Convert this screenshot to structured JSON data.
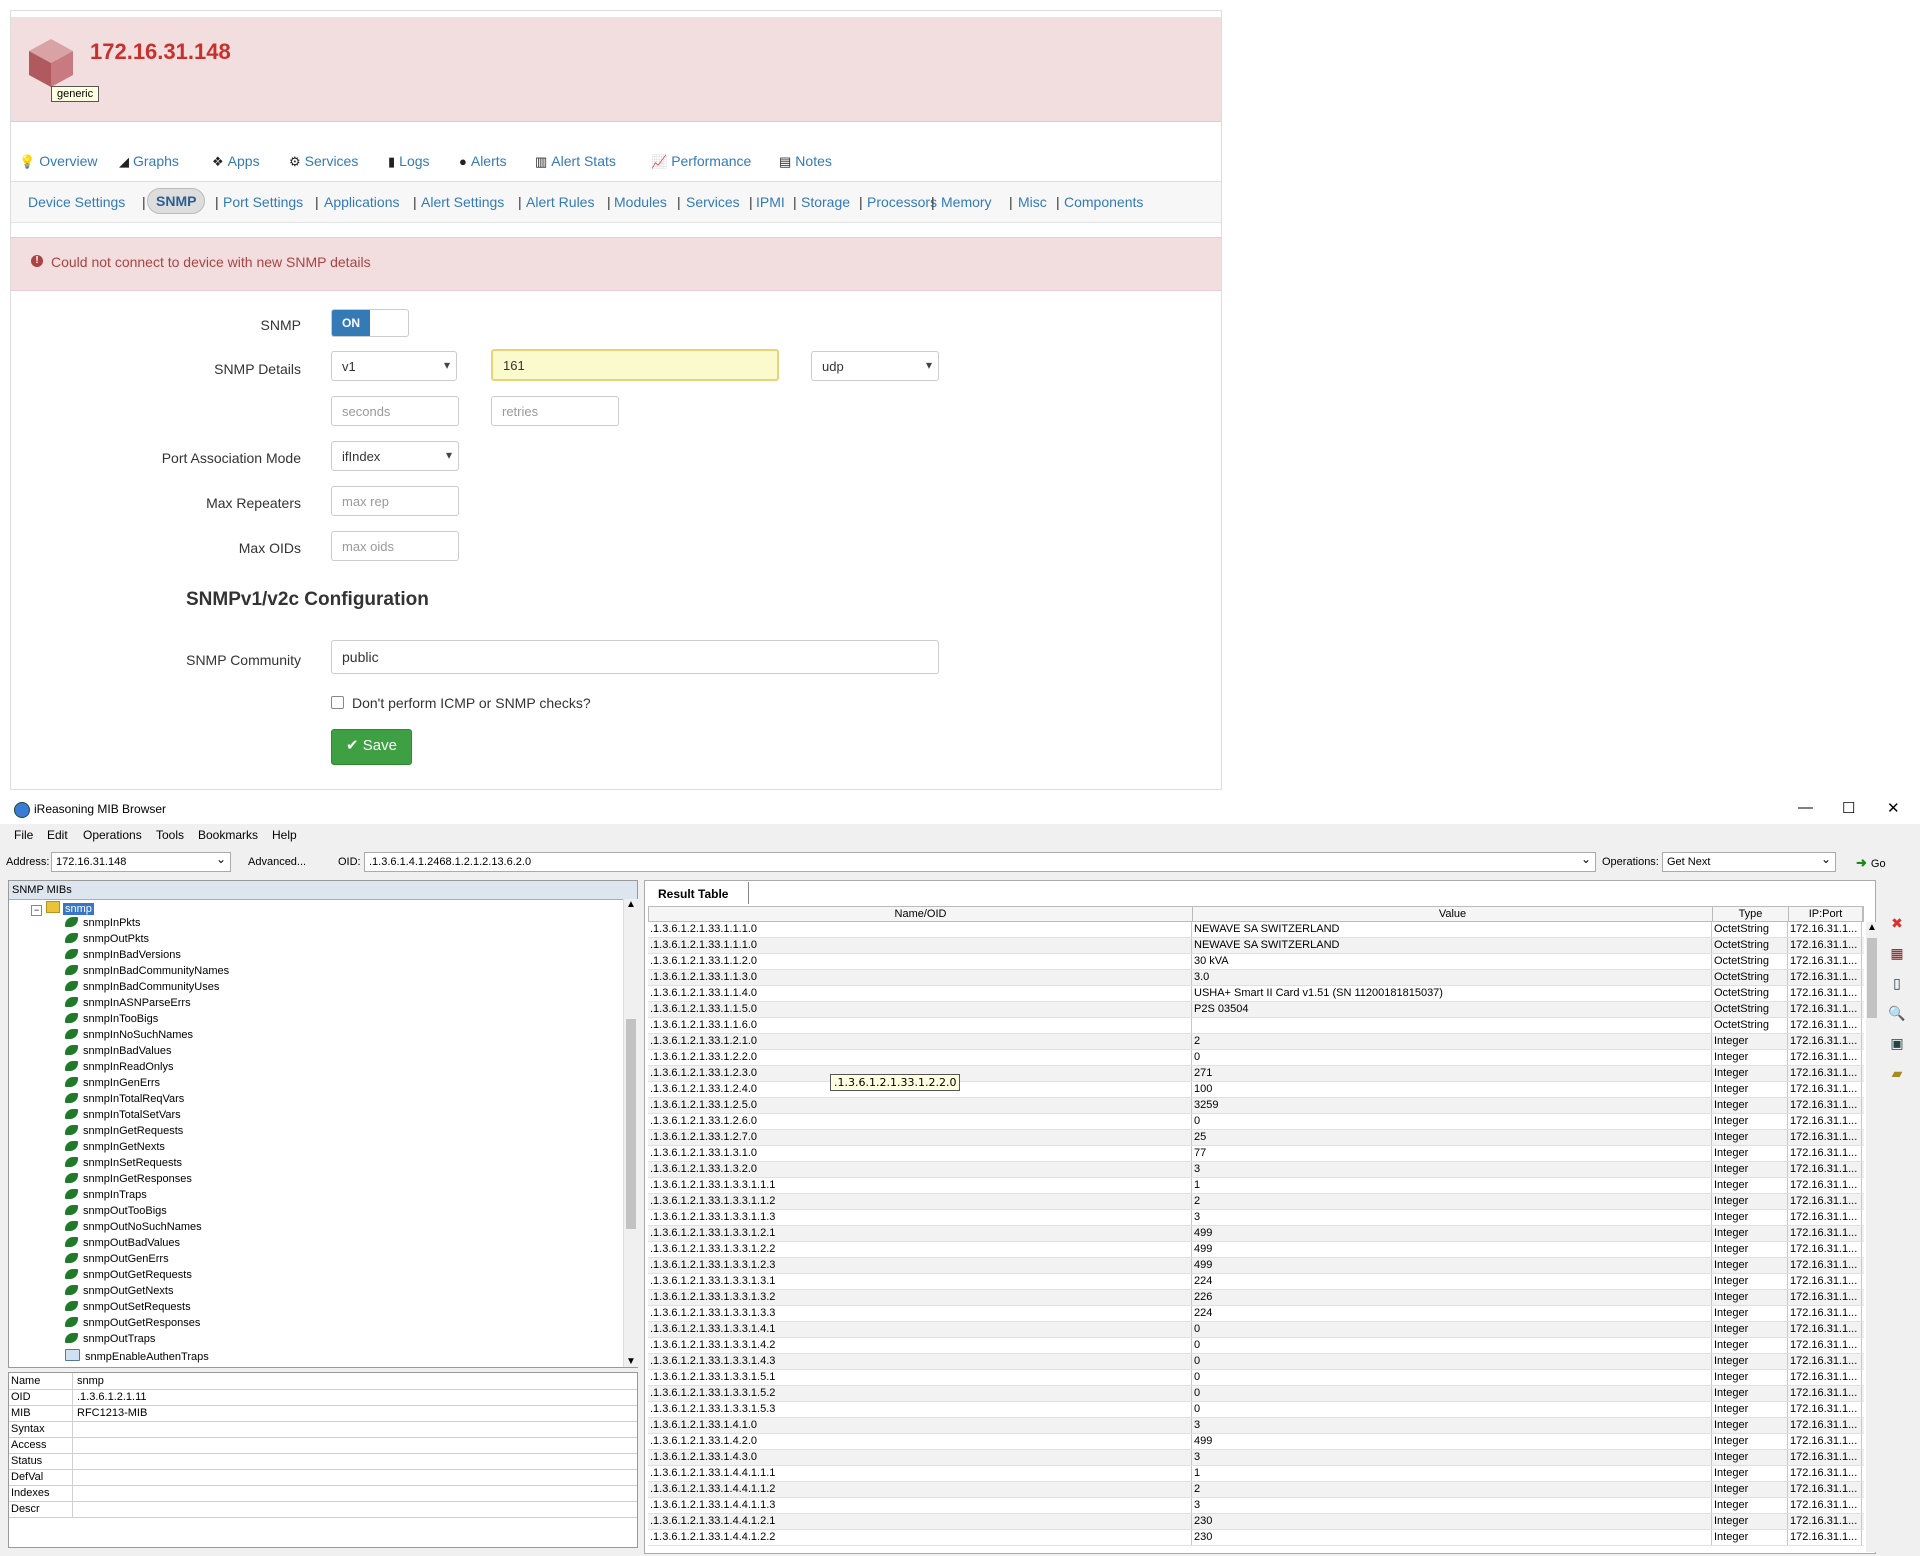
{
  "device": {
    "hostname": "172.16.31.148",
    "tooltip": "generic"
  },
  "main_nav": [
    {
      "label": "Overview",
      "icon": "lightbulb-icon",
      "glyph": "💡"
    },
    {
      "label": "Graphs",
      "icon": "area-chart-icon",
      "glyph": "◢"
    },
    {
      "label": "Apps",
      "icon": "cubes-icon",
      "glyph": "❖"
    },
    {
      "label": "Services",
      "icon": "cogs-icon",
      "glyph": "⚙"
    },
    {
      "label": "Logs",
      "icon": "book-icon",
      "glyph": "▮"
    },
    {
      "label": "Alerts",
      "icon": "exclamation-circle-icon",
      "glyph": "●"
    },
    {
      "label": "Alert Stats",
      "icon": "bar-chart-icon",
      "glyph": "▥"
    },
    {
      "label": "Performance",
      "icon": "line-chart-icon",
      "glyph": "📈"
    },
    {
      "label": "Notes",
      "icon": "file-text-icon",
      "glyph": "▤"
    }
  ],
  "sub_nav": {
    "device_settings": "Device Settings",
    "snmp": "SNMP",
    "items": [
      "Port Settings",
      "Applications",
      "Alert Settings",
      "Alert Rules",
      "Modules",
      "Services",
      "IPMI",
      "Storage",
      "Processors",
      "Memory",
      "Misc",
      "Components"
    ],
    "separator": "|"
  },
  "alert": {
    "message": "Could not connect to device with new SNMP details",
    "icon_glyph": "!"
  },
  "form": {
    "snmp_label": "SNMP",
    "snmp_toggle": "ON",
    "snmp_details_label": "SNMP Details",
    "version": "v1",
    "port": "161",
    "transport": "udp",
    "timeout_placeholder": "seconds",
    "retries_placeholder": "retries",
    "port_assoc_label": "Port Association Mode",
    "port_assoc": "ifIndex",
    "max_repeaters_label": "Max Repeaters",
    "max_repeaters_placeholder": "max rep",
    "max_oids_label": "Max OIDs",
    "max_oids_placeholder": "max oids",
    "config_title": "SNMPv1/v2c Configuration",
    "community_label": "SNMP Community",
    "community": "public",
    "no_checks_label": "Don't perform ICMP or SNMP checks?",
    "save_label": "Save",
    "save_glyph": "✔"
  },
  "mib": {
    "window_title": "iReasoning MIB Browser",
    "window_buttons": [
      "—",
      "☐",
      "✕"
    ],
    "menu": [
      "File",
      "Edit",
      "Operations",
      "Tools",
      "Bookmarks",
      "Help"
    ],
    "address_label": "Address:",
    "address": "172.16.31.148",
    "advanced_label": "Advanced...",
    "oid_label": "OID:",
    "oid": ".1.3.6.1.4.1.2468.1.2.1.2.13.6.2.0",
    "operations_label": "Operations:",
    "operation": "Get Next",
    "go_label": "Go",
    "go_glyph": "➜",
    "tree_header": "SNMP MIBs",
    "tree_root": "snmp",
    "tree_expander": "−",
    "tree_items": [
      "snmpInPkts",
      "snmpOutPkts",
      "snmpInBadVersions",
      "snmpInBadCommunityNames",
      "snmpInBadCommunityUses",
      "snmpInASNParseErrs",
      "snmpInTooBigs",
      "snmpInNoSuchNames",
      "snmpInBadValues",
      "snmpInReadOnlys",
      "snmpInGenErrs",
      "snmpInTotalReqVars",
      "snmpInTotalSetVars",
      "snmpInGetRequests",
      "snmpInGetNexts",
      "snmpInSetRequests",
      "snmpInGetResponses",
      "snmpInTraps",
      "snmpOutTooBigs",
      "snmpOutNoSuchNames",
      "snmpOutBadValues",
      "snmpOutGenErrs",
      "snmpOutGetRequests",
      "snmpOutGetNexts",
      "snmpOutSetRequests",
      "snmpOutGetResponses",
      "snmpOutTraps",
      "snmpEnableAuthenTraps"
    ],
    "scroll_up": "▲",
    "scroll_down": "▼",
    "properties": [
      {
        "k": "Name",
        "v": "snmp"
      },
      {
        "k": "OID",
        "v": ".1.3.6.1.2.1.11"
      },
      {
        "k": "MIB",
        "v": "RFC1213-MIB"
      },
      {
        "k": "Syntax",
        "v": ""
      },
      {
        "k": "Access",
        "v": ""
      },
      {
        "k": "Status",
        "v": ""
      },
      {
        "k": "DefVal",
        "v": ""
      },
      {
        "k": "Indexes",
        "v": ""
      },
      {
        "k": "Descr",
        "v": ""
      }
    ],
    "result_tab": "Result Table",
    "columns": [
      "Name/OID",
      "Value",
      "Type",
      "IP:Port"
    ],
    "rows": [
      [
        ".1.3.6.1.2.1.33.1.1.1.0",
        "NEWAVE SA  SWITZERLAND",
        "OctetString",
        "172.16.31.1..."
      ],
      [
        ".1.3.6.1.2.1.33.1.1.1.0",
        "NEWAVE SA  SWITZERLAND",
        "OctetString",
        "172.16.31.1..."
      ],
      [
        ".1.3.6.1.2.1.33.1.1.2.0",
        "30 kVA",
        "OctetString",
        "172.16.31.1..."
      ],
      [
        ".1.3.6.1.2.1.33.1.1.3.0",
        " 3.0",
        "OctetString",
        "172.16.31.1..."
      ],
      [
        ".1.3.6.1.2.1.33.1.1.4.0",
        "USHA+ Smart II Card v1.51 (SN 11200181815037)",
        "OctetString",
        "172.16.31.1..."
      ],
      [
        ".1.3.6.1.2.1.33.1.1.5.0",
        "P2S 03504",
        "OctetString",
        "172.16.31.1..."
      ],
      [
        ".1.3.6.1.2.1.33.1.1.6.0",
        "",
        "OctetString",
        "172.16.31.1..."
      ],
      [
        ".1.3.6.1.2.1.33.1.2.1.0",
        "2",
        "Integer",
        "172.16.31.1..."
      ],
      [
        ".1.3.6.1.2.1.33.1.2.2.0",
        "0",
        "Integer",
        "172.16.31.1..."
      ],
      [
        ".1.3.6.1.2.1.33.1.2.3.0",
        "271",
        "Integer",
        "172.16.31.1..."
      ],
      [
        ".1.3.6.1.2.1.33.1.2.4.0",
        "100",
        "Integer",
        "172.16.31.1..."
      ],
      [
        ".1.3.6.1.2.1.33.1.2.5.0",
        "3259",
        "Integer",
        "172.16.31.1..."
      ],
      [
        ".1.3.6.1.2.1.33.1.2.6.0",
        "0",
        "Integer",
        "172.16.31.1..."
      ],
      [
        ".1.3.6.1.2.1.33.1.2.7.0",
        "25",
        "Integer",
        "172.16.31.1..."
      ],
      [
        ".1.3.6.1.2.1.33.1.3.1.0",
        "77",
        "Integer",
        "172.16.31.1..."
      ],
      [
        ".1.3.6.1.2.1.33.1.3.2.0",
        "3",
        "Integer",
        "172.16.31.1..."
      ],
      [
        ".1.3.6.1.2.1.33.1.3.3.1.1.1",
        "1",
        "Integer",
        "172.16.31.1..."
      ],
      [
        ".1.3.6.1.2.1.33.1.3.3.1.1.2",
        "2",
        "Integer",
        "172.16.31.1..."
      ],
      [
        ".1.3.6.1.2.1.33.1.3.3.1.1.3",
        "3",
        "Integer",
        "172.16.31.1..."
      ],
      [
        ".1.3.6.1.2.1.33.1.3.3.1.2.1",
        "499",
        "Integer",
        "172.16.31.1..."
      ],
      [
        ".1.3.6.1.2.1.33.1.3.3.1.2.2",
        "499",
        "Integer",
        "172.16.31.1..."
      ],
      [
        ".1.3.6.1.2.1.33.1.3.3.1.2.3",
        "499",
        "Integer",
        "172.16.31.1..."
      ],
      [
        ".1.3.6.1.2.1.33.1.3.3.1.3.1",
        "224",
        "Integer",
        "172.16.31.1..."
      ],
      [
        ".1.3.6.1.2.1.33.1.3.3.1.3.2",
        "226",
        "Integer",
        "172.16.31.1..."
      ],
      [
        ".1.3.6.1.2.1.33.1.3.3.1.3.3",
        "224",
        "Integer",
        "172.16.31.1..."
      ],
      [
        ".1.3.6.1.2.1.33.1.3.3.1.4.1",
        "0",
        "Integer",
        "172.16.31.1..."
      ],
      [
        ".1.3.6.1.2.1.33.1.3.3.1.4.2",
        "0",
        "Integer",
        "172.16.31.1..."
      ],
      [
        ".1.3.6.1.2.1.33.1.3.3.1.4.3",
        "0",
        "Integer",
        "172.16.31.1..."
      ],
      [
        ".1.3.6.1.2.1.33.1.3.3.1.5.1",
        "0",
        "Integer",
        "172.16.31.1..."
      ],
      [
        ".1.3.6.1.2.1.33.1.3.3.1.5.2",
        "0",
        "Integer",
        "172.16.31.1..."
      ],
      [
        ".1.3.6.1.2.1.33.1.3.3.1.5.3",
        "0",
        "Integer",
        "172.16.31.1..."
      ],
      [
        ".1.3.6.1.2.1.33.1.4.1.0",
        "3",
        "Integer",
        "172.16.31.1..."
      ],
      [
        ".1.3.6.1.2.1.33.1.4.2.0",
        "499",
        "Integer",
        "172.16.31.1..."
      ],
      [
        ".1.3.6.1.2.1.33.1.4.3.0",
        "3",
        "Integer",
        "172.16.31.1..."
      ],
      [
        ".1.3.6.1.2.1.33.1.4.4.1.1.1",
        "1",
        "Integer",
        "172.16.31.1..."
      ],
      [
        ".1.3.6.1.2.1.33.1.4.4.1.1.2",
        "2",
        "Integer",
        "172.16.31.1..."
      ],
      [
        ".1.3.6.1.2.1.33.1.4.4.1.1.3",
        "3",
        "Integer",
        "172.16.31.1..."
      ],
      [
        ".1.3.6.1.2.1.33.1.4.4.1.2.1",
        "230",
        "Integer",
        "172.16.31.1..."
      ],
      [
        ".1.3.6.1.2.1.33.1.4.4.1.2.2",
        "230",
        "Integer",
        "172.16.31.1..."
      ]
    ],
    "oid_tooltip": ".1.3.6.1.2.1.33.1.2.2.0",
    "side_tools": [
      {
        "name": "stop-icon",
        "glyph": "✖",
        "color": "#d9302c"
      },
      {
        "name": "clear-icon",
        "glyph": "▦",
        "color": "#7a1a1a"
      },
      {
        "name": "export-icon",
        "glyph": "▯",
        "color": "#345"
      },
      {
        "name": "find-icon",
        "glyph": "🔍",
        "color": "#2a5fa8"
      },
      {
        "name": "graph-icon",
        "glyph": "▣",
        "color": "#244"
      },
      {
        "name": "open-icon",
        "glyph": "▰",
        "color": "#a88a22"
      }
    ]
  }
}
